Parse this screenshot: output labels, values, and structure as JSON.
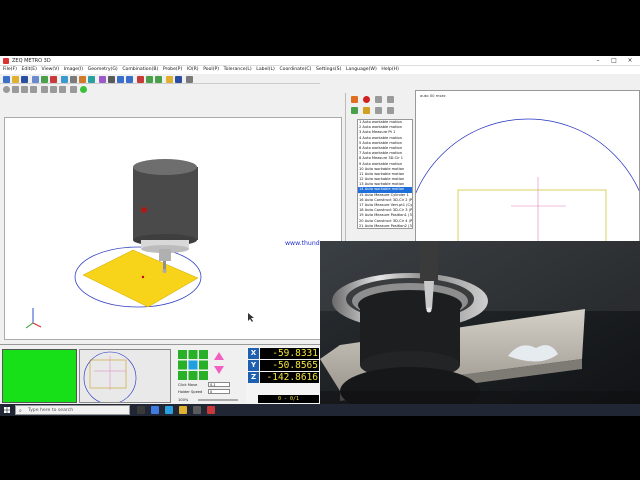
{
  "window": {
    "title": "ZEQ METRO 3D"
  },
  "menu": [
    "File(F)",
    "Edit(E)",
    "View(V)",
    "Image(I)",
    "Geometry(G)",
    "Combination(B)",
    "Probe(P)",
    "IO(R)",
    "Pool(P)",
    "Tolerance(L)",
    "Label(L)",
    "Coordinate(C)",
    "Settings(S)",
    "Language(W)",
    "Help(H)"
  ],
  "watermark": "www.thund",
  "steps": [
    "1 Auto workable motion",
    "2 Auto workable motion",
    "3 Auto Measure Pt 1",
    "4 Auto workable motion",
    "5 Auto workable motion",
    "6 Auto workable motion",
    "7 Auto workable motion",
    "8 Auto Measure 3D-Cir 1",
    "9 Auto workable motion",
    "10 Auto workable motion",
    "11 Auto workable motion",
    "12 Auto workable motion",
    "13 Auto workable motion",
    "14 Auto workable motion",
    "15 Auto Measure Cylinder 1",
    "16 Auto Construct 3D-Cir 2 (Pt...)",
    "17 Auto Measure Vert.pt1 (Cyl...)",
    "18 Auto Construct 3D-Cir 3 (Pt...)",
    "19 Auto Measure Position1 (3D...)",
    "20 Auto Construct 3D-Cir 4 (Pt...)",
    "21 Auto Measure Position2 (3D...)"
  ],
  "selected_step": 13,
  "camera": {
    "caption": "auto 00 msec"
  },
  "motion": {
    "click_move_label": "Click Move",
    "click_move_value": "0.1",
    "holder_speed_label": "Holder Speed",
    "holder_speed_value": "0",
    "zoom_label": "100%"
  },
  "dro": {
    "x_axis": "X",
    "x_value": "-59.8331",
    "y_axis": "Y",
    "y_value": "-50.8565",
    "z_axis": "Z",
    "z_value": "-142.8616",
    "status": "0 - 0/1"
  },
  "taskbar": {
    "search_placeholder": "Type here to search"
  },
  "colors": {
    "dro_text": "#f4e43c",
    "axis_label_bg": "#1e5fb0",
    "selected_row": "#1e6fd9",
    "green_panel": "#18e018"
  }
}
